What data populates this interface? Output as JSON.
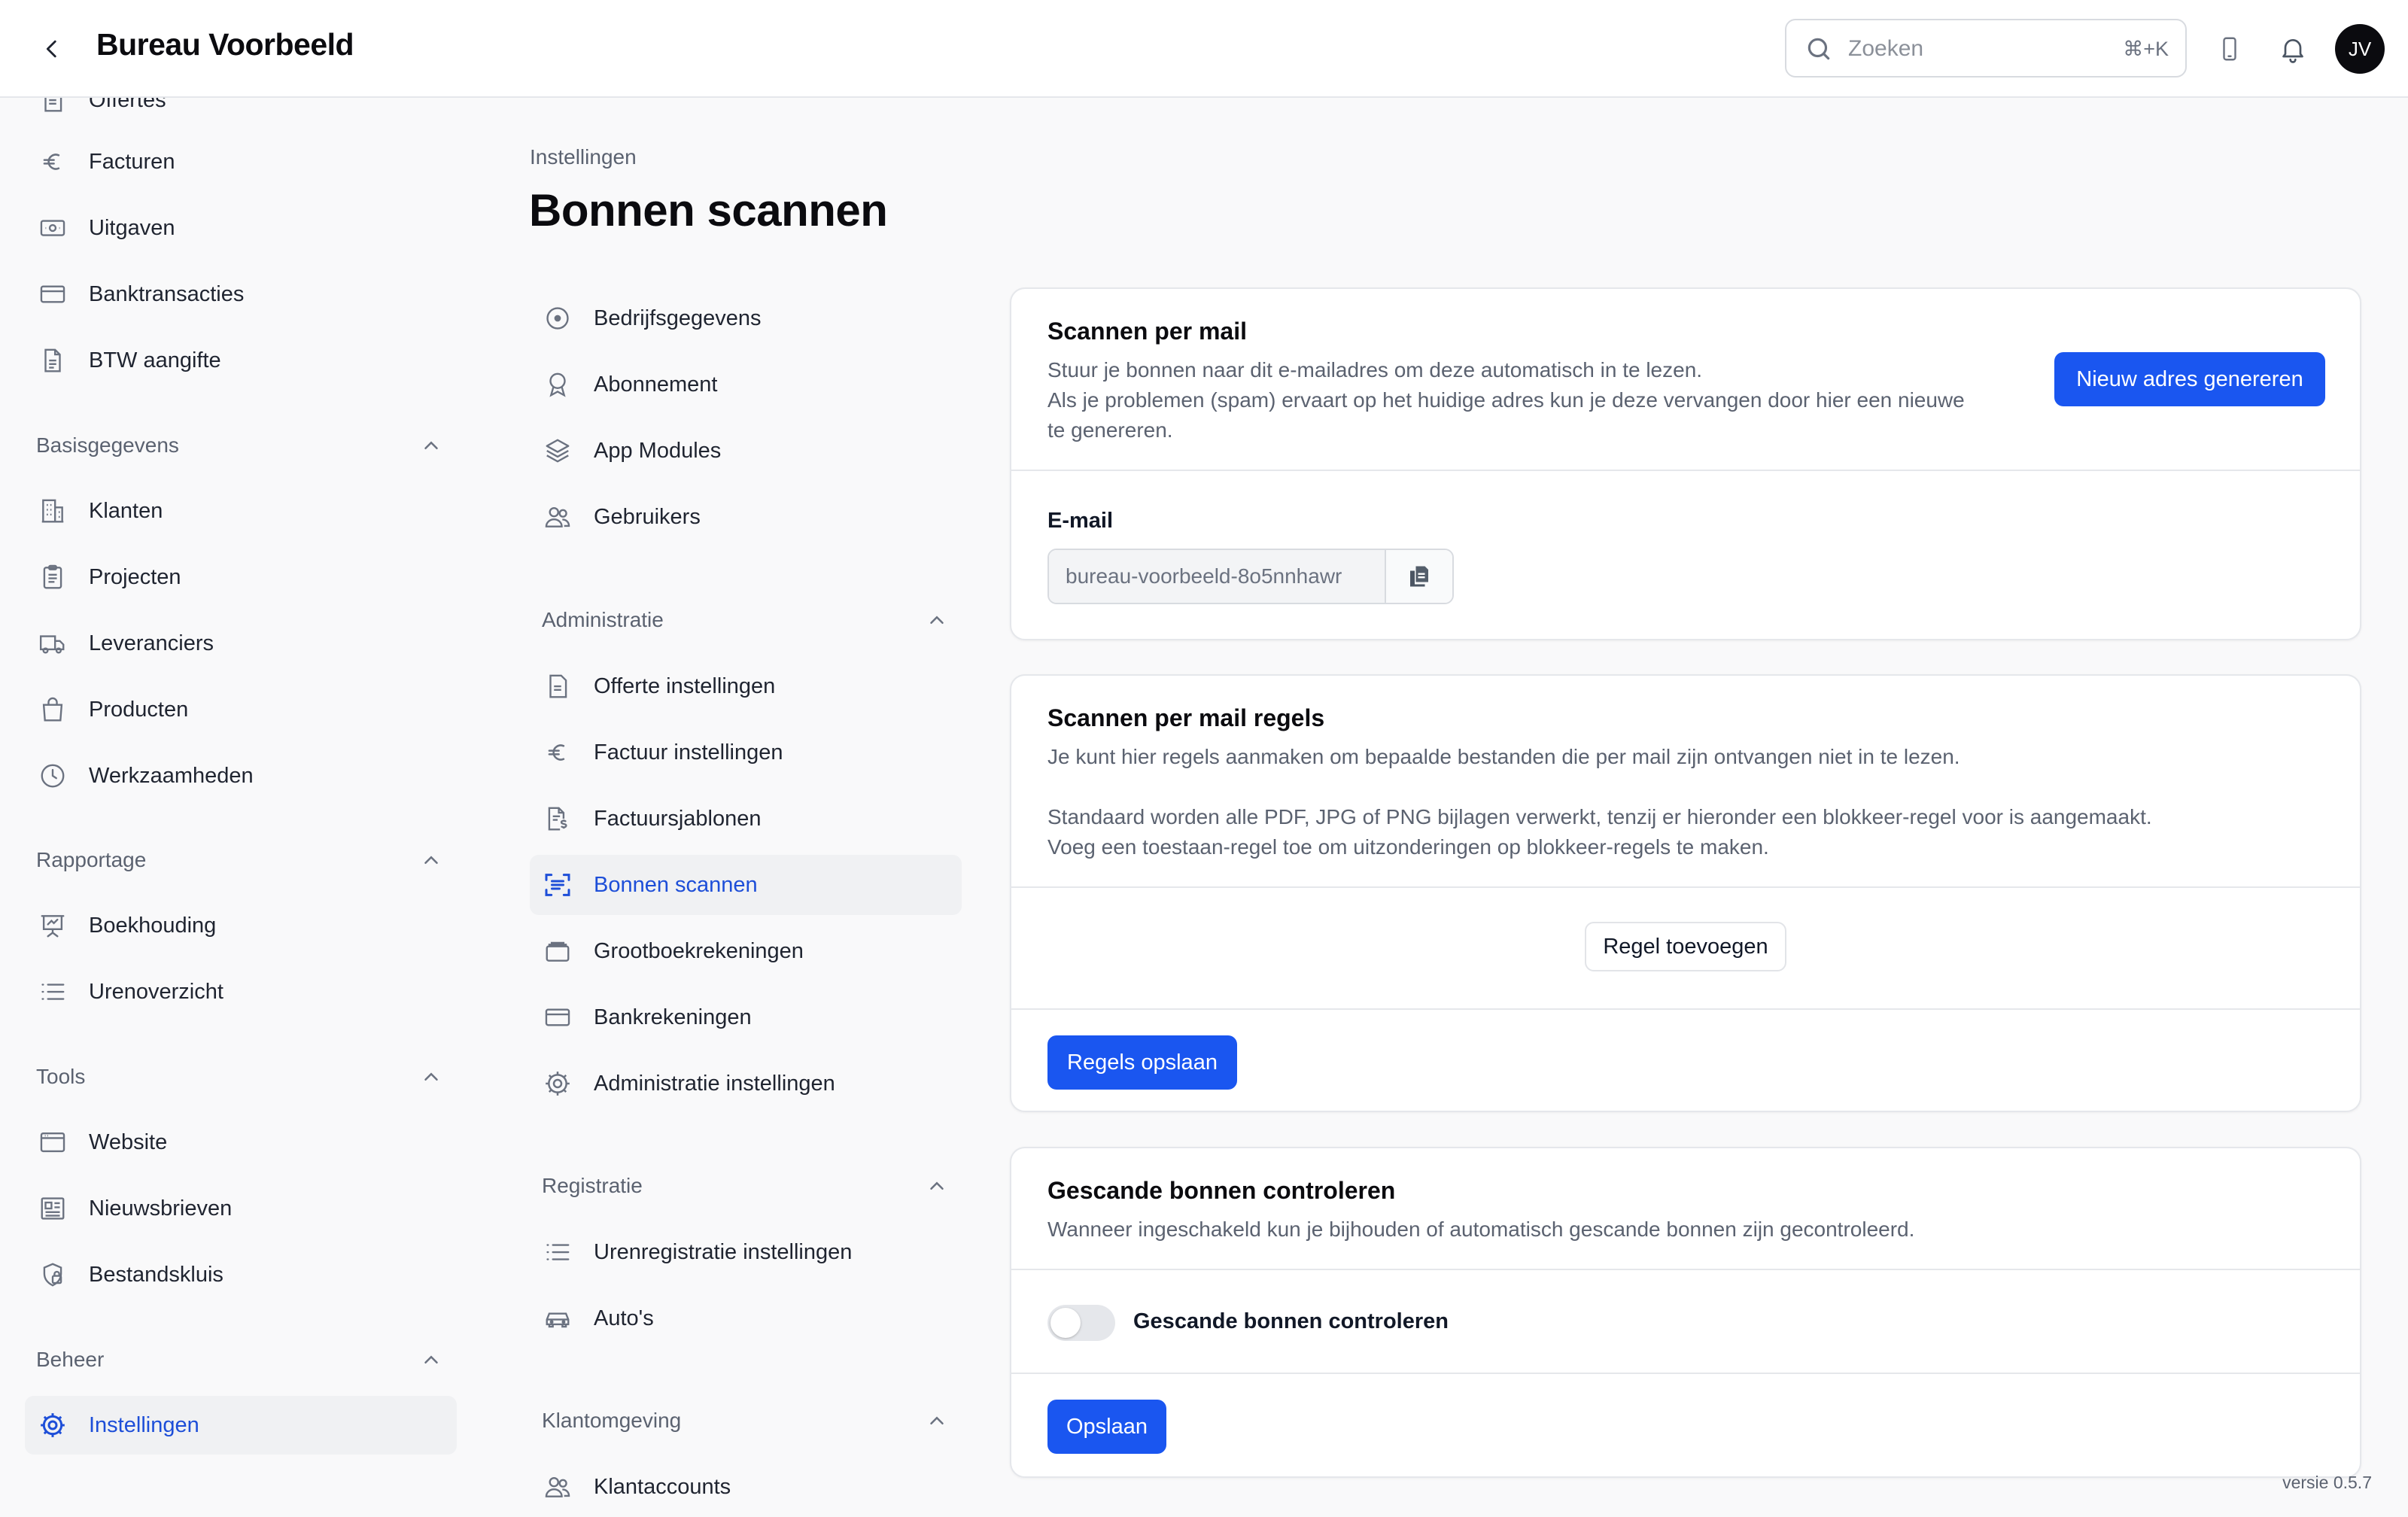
{
  "header": {
    "title": "Bureau Voorbeeld",
    "search_placeholder": "Zoeken",
    "search_shortcut": "⌘+K",
    "avatar_initials": "JV"
  },
  "sidebar": {
    "items_top": [
      {
        "label": "Offertes",
        "icon": "quote-document-icon"
      },
      {
        "label": "Facturen",
        "icon": "euro-icon"
      },
      {
        "label": "Uitgaven",
        "icon": "banknote-icon"
      },
      {
        "label": "Banktransacties",
        "icon": "credit-card-icon"
      },
      {
        "label": "BTW aangifte",
        "icon": "document-icon"
      }
    ],
    "sections": [
      {
        "label": "Basisgegevens",
        "items": [
          {
            "label": "Klanten",
            "icon": "building-icon"
          },
          {
            "label": "Projecten",
            "icon": "clipboard-icon"
          },
          {
            "label": "Leveranciers",
            "icon": "truck-icon"
          },
          {
            "label": "Producten",
            "icon": "shopping-bag-icon"
          },
          {
            "label": "Werkzaamheden",
            "icon": "clock-icon"
          }
        ]
      },
      {
        "label": "Rapportage",
        "items": [
          {
            "label": "Boekhouding",
            "icon": "presentation-chart-icon"
          },
          {
            "label": "Urenoverzicht",
            "icon": "list-icon"
          }
        ]
      },
      {
        "label": "Tools",
        "items": [
          {
            "label": "Website",
            "icon": "browser-window-icon"
          },
          {
            "label": "Nieuwsbrieven",
            "icon": "newspaper-icon"
          },
          {
            "label": "Bestandskluis",
            "icon": "shield-lock-icon"
          }
        ]
      },
      {
        "label": "Beheer",
        "items": [
          {
            "label": "Instellingen",
            "icon": "gear-icon",
            "active": true
          }
        ]
      }
    ]
  },
  "page": {
    "breadcrumb": "Instellingen",
    "title": "Bonnen scannen"
  },
  "settings_nav": {
    "general": [
      {
        "label": "Bedrijfsgegevens",
        "icon": "target-icon"
      },
      {
        "label": "Abonnement",
        "icon": "award-icon"
      },
      {
        "label": "App Modules",
        "icon": "layers-icon"
      },
      {
        "label": "Gebruikers",
        "icon": "users-icon"
      }
    ],
    "sections": [
      {
        "label": "Administratie",
        "items": [
          {
            "label": "Offerte instellingen",
            "icon": "quote-document-icon"
          },
          {
            "label": "Factuur instellingen",
            "icon": "euro-icon"
          },
          {
            "label": "Factuursjablonen",
            "icon": "invoice-template-icon"
          },
          {
            "label": "Bonnen scannen",
            "icon": "scan-icon",
            "active": true
          },
          {
            "label": "Grootboekrekeningen",
            "icon": "archive-icon"
          },
          {
            "label": "Bankrekeningen",
            "icon": "credit-card-icon"
          },
          {
            "label": "Administratie instellingen",
            "icon": "gear-icon"
          }
        ]
      },
      {
        "label": "Registratie",
        "items": [
          {
            "label": "Urenregistratie instellingen",
            "icon": "list-icon"
          },
          {
            "label": "Auto's",
            "icon": "car-icon"
          }
        ]
      },
      {
        "label": "Klantomgeving",
        "items": [
          {
            "label": "Klantaccounts",
            "icon": "users-icon"
          }
        ]
      }
    ]
  },
  "cards": {
    "mail": {
      "title": "Scannen per mail",
      "desc_line1": "Stuur je bonnen naar dit e-mailadres om deze automatisch in te lezen.",
      "desc_line2": "Als je problemen (spam) ervaart op het huidige adres kun je deze vervangen door hier een nieuwe",
      "desc_line3": "te genereren.",
      "button": "Nieuw adres genereren",
      "email_label": "E-mail",
      "email_value": "bureau-voorbeeld-8o5nnhawr"
    },
    "rules": {
      "title": "Scannen per mail regels",
      "desc_line1": "Je kunt hier regels aanmaken om bepaalde bestanden die per mail zijn ontvangen niet in te lezen.",
      "desc_line2": "Standaard worden alle PDF, JPG of PNG bijlagen verwerkt, tenzij er hieronder een blokkeer-regel voor is aangemaakt.",
      "desc_line3": "Voeg een toestaan-regel toe om uitzonderingen op blokkeer-regels te maken.",
      "add_button": "Regel toevoegen",
      "save_button": "Regels opslaan"
    },
    "check": {
      "title": "Gescande bonnen controleren",
      "desc": "Wanneer ingeschakeld kun je bijhouden of automatisch gescande bonnen zijn gecontroleerd.",
      "toggle_label": "Gescande bonnen controleren",
      "toggle_on": false,
      "save_button": "Opslaan"
    }
  },
  "footer": {
    "version": "versie 0.5.7"
  },
  "colors": {
    "accent": "#1a56f0",
    "active_text": "#1d4ed8"
  }
}
